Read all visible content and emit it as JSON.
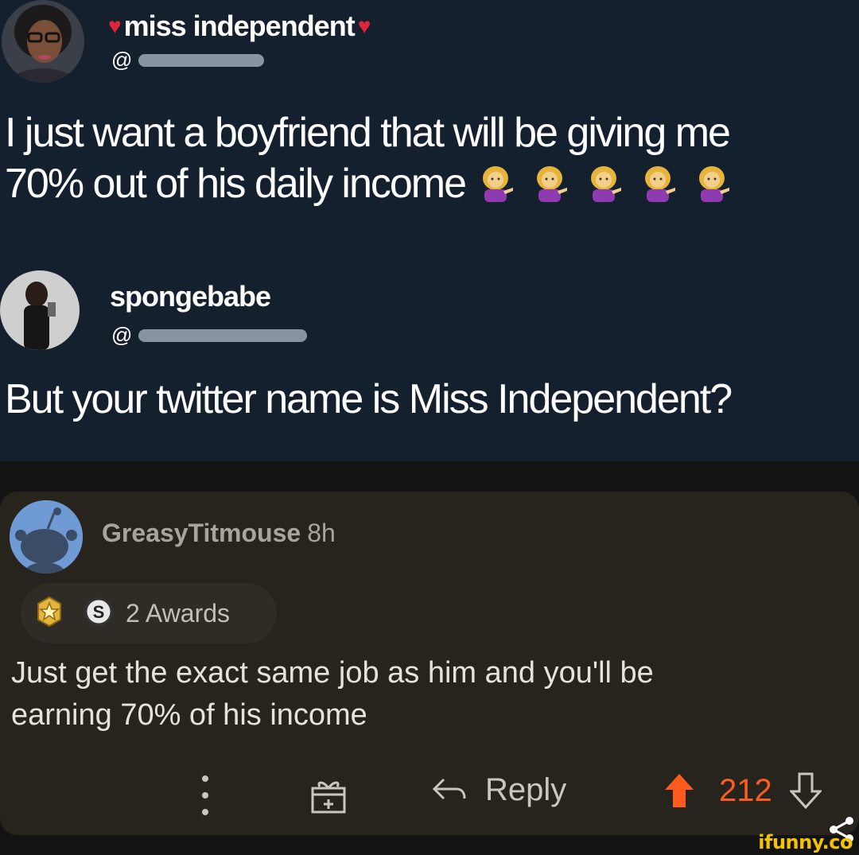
{
  "tweet1": {
    "display_name": "miss independent",
    "handle_prefix": "@",
    "text_line1": "I just want a boyfriend that will be giving me",
    "text_line2": "70% out of his daily income"
  },
  "tweet2": {
    "display_name": "spongebabe",
    "handle_prefix": "@",
    "text": "But your twitter name is Miss Independent?"
  },
  "comment": {
    "username": "GreasyTitmouse",
    "age": "8h",
    "awards_label": "2 Awards",
    "body_line1": "Just get the exact same job as him and you'll be",
    "body_line2": "earning 70% of his income",
    "reply_label": "Reply",
    "score": "212"
  },
  "watermark": "ifunny.co",
  "icons": {
    "heart": "heart-icon",
    "emoji": "person-tipping-hand-emoji",
    "award1": "gold-star-award-icon",
    "award2": "silver-s-award-icon",
    "more": "more-options-icon",
    "gift": "gift-award-icon",
    "reply": "reply-arrow-icon",
    "upvote": "upvote-icon",
    "downvote": "downvote-icon",
    "share": "share-icon"
  },
  "colors": {
    "twitter_bg": "#15202e",
    "card_bg": "#27241d",
    "upvote": "#ff5a1f",
    "heart": "#e0243c"
  }
}
